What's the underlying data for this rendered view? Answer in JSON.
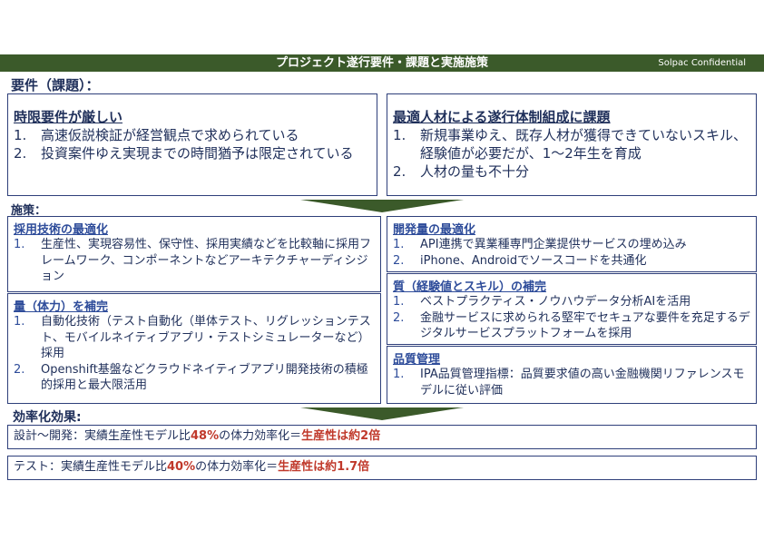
{
  "header": {
    "title": "プロジェクト遂行要件・課題と実施施策",
    "confidential": "Solpac Confidential"
  },
  "requirements_label": "要件（課題）：",
  "req_left": {
    "title": "時限要件が厳しい",
    "items": [
      {
        "num": "1.",
        "text": "高速仮説検証が経営観点で求められている"
      },
      {
        "num": "2.",
        "text": "投資案件ゆえ実現までの時間猶予は限定されている"
      }
    ]
  },
  "req_right": {
    "title": "最適人材による遂行体制組成に課題",
    "items": [
      {
        "num": "1.",
        "text": "新規事業ゆえ、既存人材が獲得できていないスキル、経験値が必要だが、1～2年生を育成"
      },
      {
        "num": "2.",
        "text": "人材の量も不十分"
      }
    ]
  },
  "measures_label": "施策：",
  "m_tech": {
    "title": "採用技術の最適化",
    "items": [
      {
        "num": "1.",
        "text": "生産性、実現容易性、保守性、採用実績などを比較軸に採用フレームワーク、コンポーネントなどアーキテクチャーディシジョン"
      }
    ]
  },
  "m_qty": {
    "title": "量（体力）を補完",
    "items": [
      {
        "num": "1.",
        "text": "自動化技術（テスト自動化（単体テスト、リグレッションテスト、モバイルネイティブアプリ・テストシミュレーターなど）採用"
      },
      {
        "num": "2.",
        "text": "Openshift基盤などクラウドネイティブアプリ開発技術の積極的採用と最大限活用"
      }
    ]
  },
  "m_dev": {
    "title": "開発量の最適化",
    "items": [
      {
        "num": "1.",
        "text": "API連携で異業種専門企業提供サービスの埋め込み"
      },
      {
        "num": "2.",
        "text": "iPhone、Androidでソースコードを共通化"
      }
    ]
  },
  "m_quality": {
    "title": "質（経験値とスキル）の補完",
    "items": [
      {
        "num": "1.",
        "text": "ベストプラクティス・ノウハウデータ分析AIを活用"
      },
      {
        "num": "2.",
        "text": "金融サービスに求められる堅牢でセキュアな要件を充足するデジタルサービスプラットフォームを採用"
      }
    ]
  },
  "m_qc": {
    "title": "品質管理",
    "items": [
      {
        "num": "1.",
        "text": "IPA品質管理指標：品質要求値の高い金融機関リファレンスモデルに従い評価"
      }
    ]
  },
  "efficiency": {
    "label": "効率化効果:",
    "line1": {
      "pre": "設計～開発：実績生産性モデル比",
      "pct": "48%",
      "mid": "の体力効率化＝",
      "result": "生産性は約2倍"
    },
    "line2": {
      "pre": "テスト：実績生産性モデル比",
      "pct": "40%",
      "mid": "の体力効率化＝",
      "result": "生産性は約1.7倍"
    }
  },
  "colors": {
    "header_green": "#3b5a2a",
    "border_navy": "#2e3f7a",
    "highlight_red": "#c0392b"
  }
}
